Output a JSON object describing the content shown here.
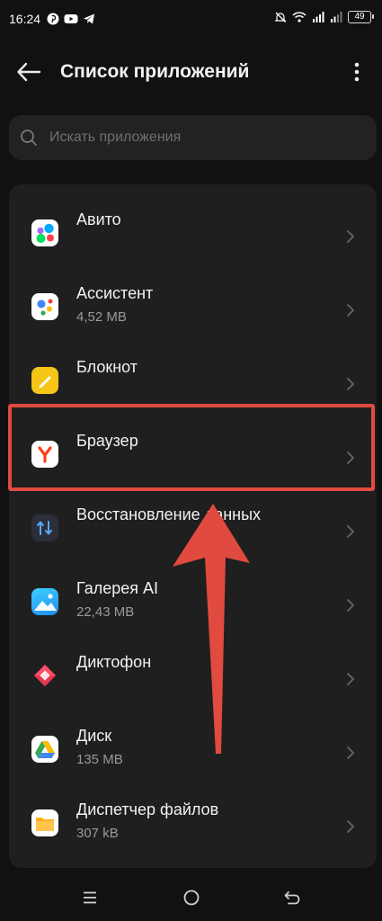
{
  "status_bar": {
    "time": "16:24",
    "left_icons": [
      "pinterest-icon",
      "youtube-icon",
      "telegram-icon"
    ],
    "right_icons": [
      "mute-icon",
      "wifi-icon",
      "signal-icon",
      "signal-icon"
    ],
    "battery_level": "49"
  },
  "header": {
    "title": "Список приложений",
    "back_icon": "arrow-left-icon",
    "more_icon": "more-vertical-icon"
  },
  "search": {
    "placeholder": "Искать приложения"
  },
  "apps": [
    {
      "name": "Авито",
      "size": "",
      "icon": "avito-icon"
    },
    {
      "name": "Ассистент",
      "size": "4,52 MB",
      "icon": "assistant-icon"
    },
    {
      "name": "Блокнот",
      "size": "",
      "icon": "notepad-icon"
    },
    {
      "name": "Браузер",
      "size": "",
      "icon": "yandex-browser-icon"
    },
    {
      "name": "Восстановление данных",
      "size": "",
      "icon": "data-recovery-icon"
    },
    {
      "name": "Галерея AI",
      "size": "22,43 MB",
      "icon": "gallery-icon"
    },
    {
      "name": "Диктофон",
      "size": "",
      "icon": "recorder-icon"
    },
    {
      "name": "Диск",
      "size": "135 MB",
      "icon": "google-drive-icon"
    },
    {
      "name": "Диспетчер файлов",
      "size": "307 kB",
      "icon": "file-manager-icon"
    }
  ],
  "annotation": {
    "highlight_color": "#e04a3f",
    "highlighted_app": "Браузер"
  },
  "navigation": [
    "menu-icon",
    "home-icon",
    "back-icon"
  ],
  "colors": {
    "background": "#111111",
    "card": "#1f1f1f",
    "text": "#f2f2f2",
    "secondary_text": "#9a9a9a",
    "accent_red": "#e04a3f"
  }
}
